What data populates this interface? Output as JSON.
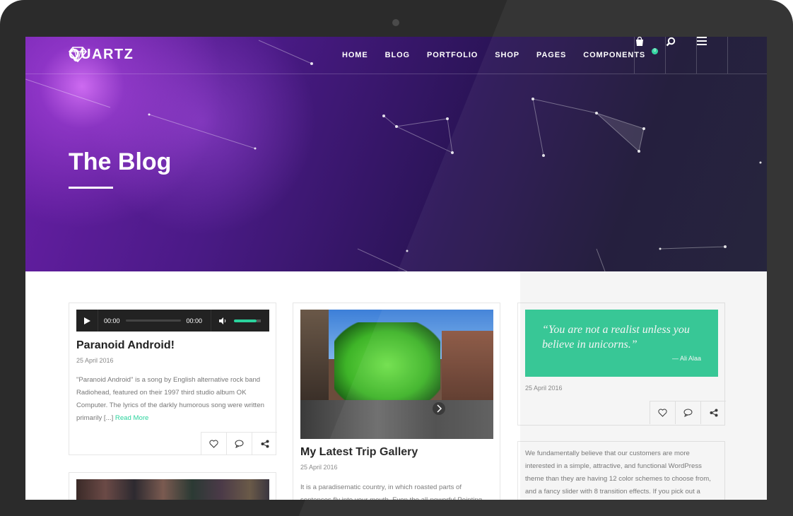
{
  "site": {
    "logo": "QUARTZ"
  },
  "nav": {
    "items": [
      "HOME",
      "BLOG",
      "PORTFOLIO",
      "SHOP",
      "PAGES",
      "COMPONENTS"
    ],
    "cart_count": "0"
  },
  "hero": {
    "title": "The Blog"
  },
  "posts": {
    "audio": {
      "current_time": "00:00",
      "duration": "00:00",
      "title": "Paranoid Android!",
      "date": "25 April 2016",
      "excerpt": "\"Paranoid Android\" is a song by English alternative rock band Radiohead, featured on their 1997 third studio album OK Computer. The lyrics of the darkly humorous song were written primarily [...]",
      "read_more": "Read More"
    },
    "gallery": {
      "title": "My Latest Trip Gallery",
      "date": "25 April 2016",
      "excerpt": "It is a paradisematic country, in which roasted parts of sentences fly into your mouth. Even the all-powerful Pointing"
    },
    "quote": {
      "text": "“You are not a realist unless you believe in unicorns.”",
      "author": "— Ali Alaa",
      "date": "25 April 2016"
    },
    "text": {
      "excerpt": "We fundamentally believe that our customers are more interested in a simple, attractive, and functional WordPress theme than they are having 12 color schemes to choose from, and a fancy slider with 8 transition effects. If you pick out a"
    }
  },
  "colors": {
    "accent": "#2bd39d",
    "hero_start": "#6a1fa8",
    "hero_end": "#1b1a33"
  }
}
